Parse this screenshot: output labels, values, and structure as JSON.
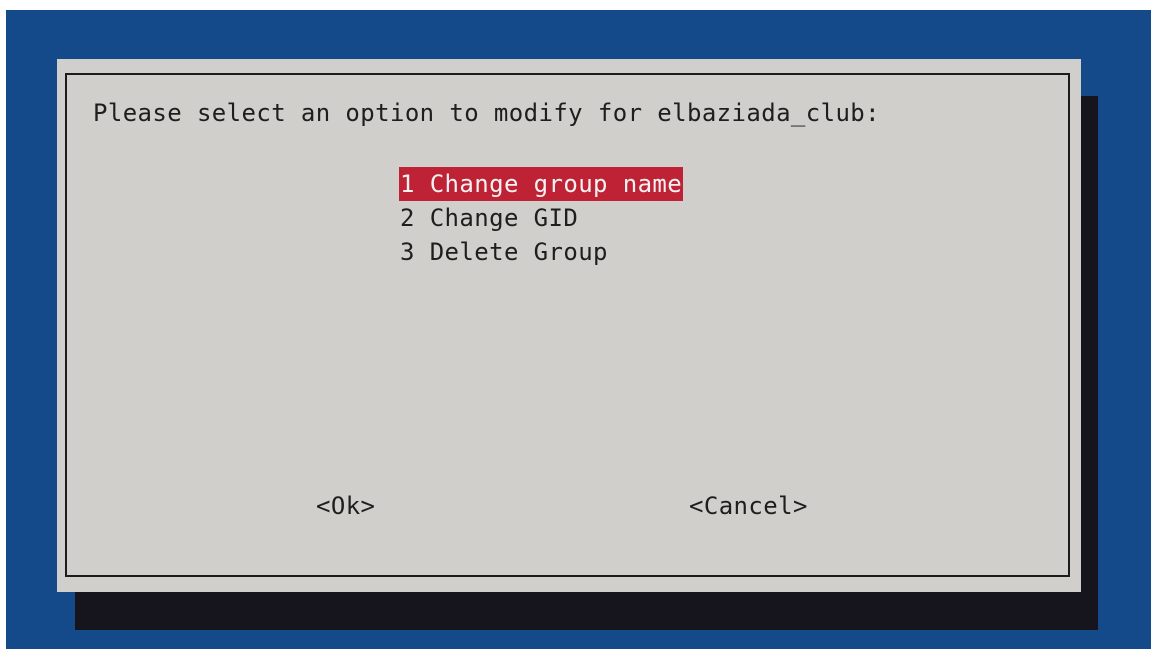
{
  "dialog": {
    "prompt": "Please select an option to modify for elbaziada_club:",
    "menu": [
      {
        "label": "1 Change group name",
        "selected": true
      },
      {
        "label": "2 Change GID",
        "selected": false
      },
      {
        "label": "3 Delete Group",
        "selected": false
      }
    ],
    "buttons": {
      "ok": "<Ok>",
      "cancel": "<Cancel>"
    }
  },
  "colors": {
    "background": "#144a8a",
    "dialog": "#d0cfcc",
    "shadow": "#16151d",
    "highlight": "#c02235"
  }
}
